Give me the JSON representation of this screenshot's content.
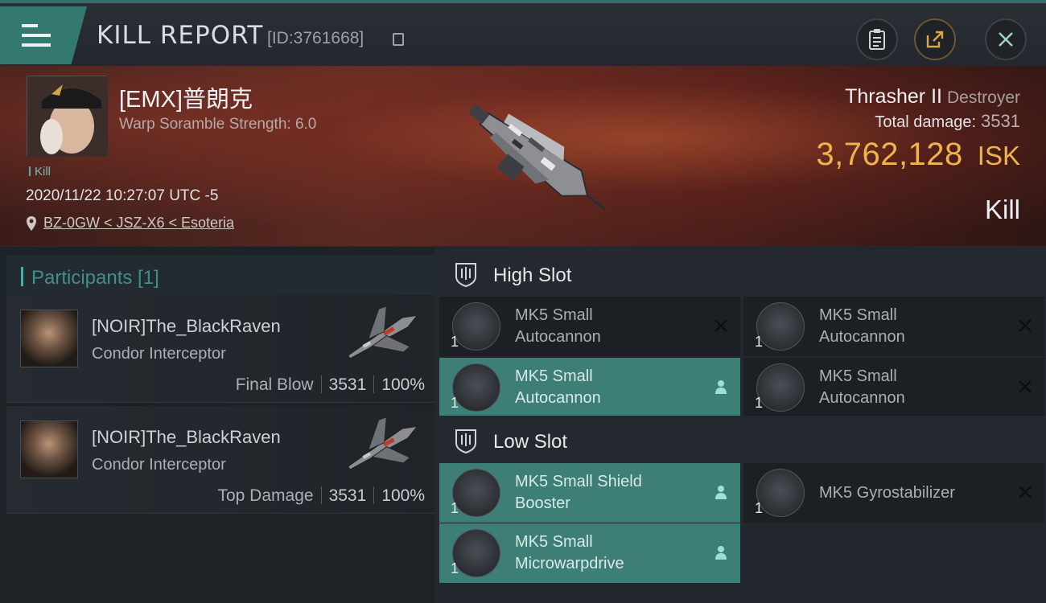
{
  "header": {
    "title": "KILL REPORT",
    "report_id": "[ID:3761668]"
  },
  "victim": {
    "name": "[EMX]普朗克",
    "subtitle": "Warp Soramble Strength: 6.0",
    "tag": "Kill",
    "datetime": "2020/11/22 10:27:07 UTC -5",
    "location": "BZ-0GW < JSZ-X6 < Esoteria",
    "ship_name": "Thrasher II",
    "ship_class": "Destroyer",
    "damage_label": "Total damage:",
    "damage_value": "3531",
    "isk_amount": "3,762,128",
    "isk_unit": "ISK",
    "result": "Kill"
  },
  "participants": {
    "title": "Participants [1]",
    "rows": [
      {
        "name": "[NOIR]The_BlackRaven",
        "ship": "Condor Interceptor",
        "role": "Final Blow",
        "damage": "3531",
        "percent": "100%"
      },
      {
        "name": "[NOIR]The_BlackRaven",
        "ship": "Condor Interceptor",
        "role": "Top Damage",
        "damage": "3531",
        "percent": "100%"
      }
    ]
  },
  "fittings": {
    "high_slot": {
      "title": "High Slot",
      "modules": [
        {
          "qty": "1",
          "name_line1": "MK5 Small",
          "name_line2": "Autocannon",
          "state": "destroyed"
        },
        {
          "qty": "1",
          "name_line1": "MK5 Small",
          "name_line2": "Autocannon",
          "state": "destroyed"
        },
        {
          "qty": "1",
          "name_line1": "MK5 Small",
          "name_line2": "Autocannon",
          "state": "dropped"
        },
        {
          "qty": "1",
          "name_line1": "MK5 Small",
          "name_line2": "Autocannon",
          "state": "destroyed"
        }
      ]
    },
    "low_slot": {
      "title": "Low Slot",
      "modules": [
        {
          "qty": "1",
          "name_line1": "MK5 Small Shield",
          "name_line2": "Booster",
          "state": "dropped"
        },
        {
          "qty": "1",
          "name_line1": "MK5 Gyrostabilizer",
          "name_line2": "",
          "state": "destroyed"
        },
        {
          "qty": "1",
          "name_line1": "MK5 Small",
          "name_line2": "Microwarpdrive",
          "state": "dropped"
        }
      ]
    }
  },
  "colors": {
    "accent": "#3d7f76",
    "isk": "#f0b24a",
    "header_teal": "#34796f"
  },
  "icons": [
    "menu-icon",
    "clipboard-icon",
    "share-icon",
    "close-icon",
    "copy-icon",
    "location-pin-icon",
    "slot-shield-icon",
    "destroyed-x-icon",
    "dropped-person-icon"
  ]
}
